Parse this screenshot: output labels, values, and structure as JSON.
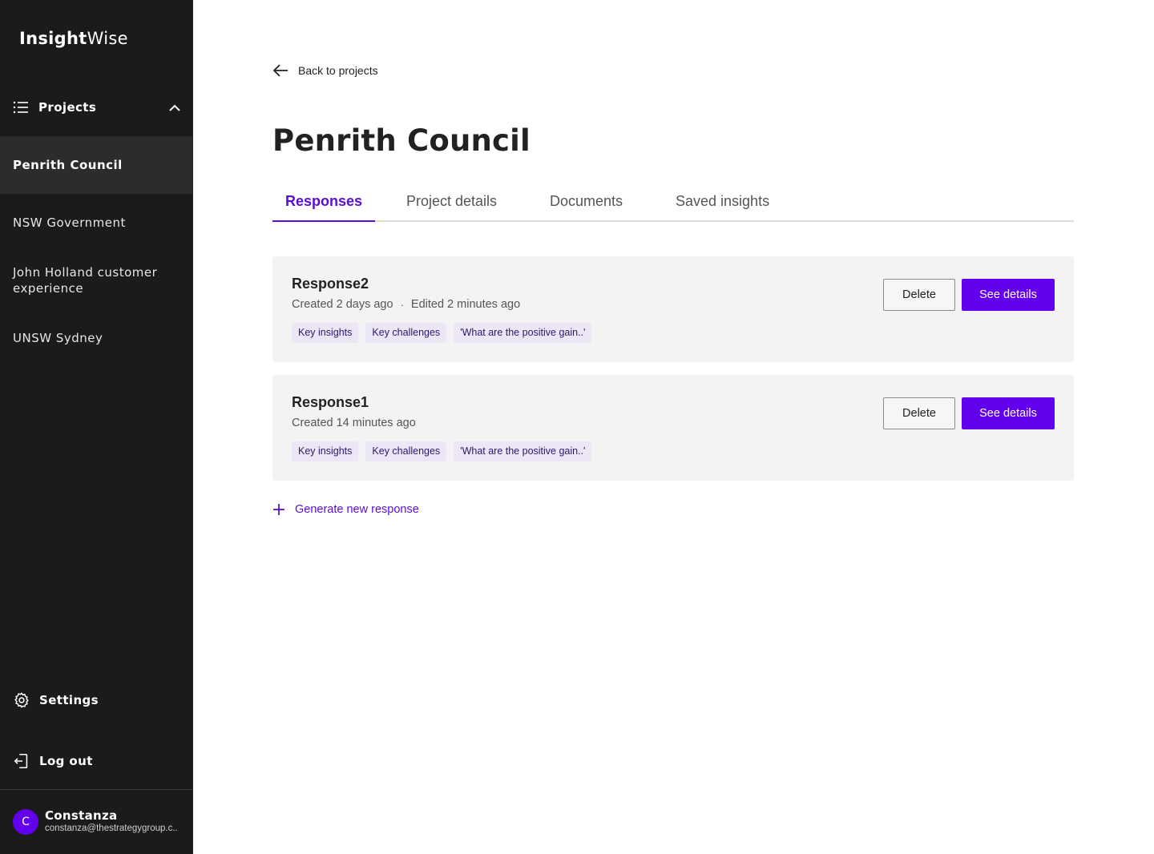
{
  "app": {
    "logo_bold": "Insight",
    "logo_regular": "Wise"
  },
  "sidebar": {
    "projects_label": "Projects",
    "projects": [
      {
        "label": "Penrith Council",
        "active": true
      },
      {
        "label": "NSW Government",
        "active": false
      },
      {
        "label": "John Holland customer experience",
        "active": false
      },
      {
        "label": "UNSW Sydney",
        "active": false
      }
    ],
    "settings_label": "Settings",
    "logout_label": "Log out",
    "user": {
      "initial": "C",
      "name": "Constanza",
      "email": "constanza@thestrategygroup.c.."
    }
  },
  "main": {
    "back_label": "Back to projects",
    "title": "Penrith Council",
    "tabs": [
      {
        "label": "Responses",
        "active": true
      },
      {
        "label": "Project details",
        "active": false
      },
      {
        "label": "Documents",
        "active": false
      },
      {
        "label": "Saved insights",
        "active": false
      }
    ],
    "responses": [
      {
        "title": "Response2",
        "created": "Created 2 days ago",
        "separator": "·",
        "edited": "Edited 2 minutes ago",
        "tags": [
          "Key insights",
          "Key challenges",
          "'What are the positive gain..'"
        ],
        "delete_label": "Delete",
        "details_label": "See details"
      },
      {
        "title": "Response1",
        "created": "Created 14 minutes ago",
        "tags": [
          "Key insights",
          "Key challenges",
          "'What are the positive gain..'"
        ],
        "delete_label": "Delete",
        "details_label": "See details"
      }
    ],
    "generate_label": "Generate new response"
  },
  "colors": {
    "accent": "#6200ee",
    "sidebar_bg": "#1b1b1b",
    "card_bg": "#f3f3f3",
    "tag_bg": "#ece6f6"
  },
  "icons": {
    "projects": "list-icon",
    "collapse": "chevron-up-icon",
    "back": "arrow-left-icon",
    "settings": "gear-icon",
    "logout": "logout-icon",
    "generate": "plus-icon"
  }
}
